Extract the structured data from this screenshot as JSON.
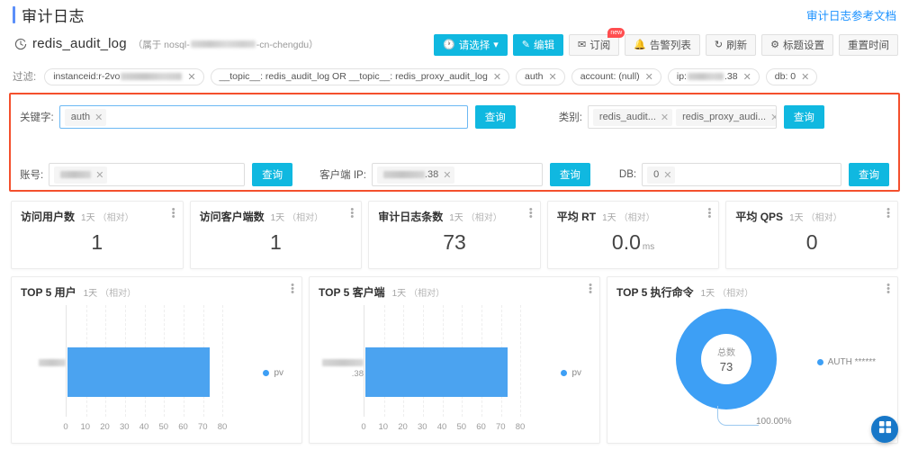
{
  "header": {
    "title": "审计日志",
    "doc_link": "审计日志参考文档"
  },
  "instance": {
    "name": "redis_audit_log",
    "sub_prefix": "（属于 nosql-",
    "sub_suffix": "-cn-chengdu）",
    "icon": "clock-refresh-icon"
  },
  "toolbar": {
    "time_select": "请选择",
    "edit": "编辑",
    "subscribe": "订阅",
    "subscribe_badge": "new",
    "alarm_list": "告警列表",
    "refresh": "刷新",
    "title_setting": "标题设置",
    "reset_time": "重置时间"
  },
  "filters": {
    "label": "过滤:",
    "tags": [
      {
        "text": "instanceid:r-2vo",
        "blurred": true,
        "blur_kind": "wide"
      },
      {
        "text": "__topic__: redis_audit_log OR __topic__: redis_proxy_audit_log",
        "blurred": false
      },
      {
        "text": "auth",
        "blurred": false
      },
      {
        "text": "account: (null)",
        "blurred": false
      },
      {
        "text": "ip:",
        "suffix": ".38",
        "blurred": true,
        "blur_kind": "ip"
      },
      {
        "text": "db: 0",
        "blurred": false
      }
    ]
  },
  "search_panel": {
    "accent_color": "#f4502d",
    "keyword": {
      "label": "关键字:",
      "chip": "auth",
      "button": "查询"
    },
    "category": {
      "label": "类别:",
      "chips": [
        "redis_audit...",
        "redis_proxy_audi..."
      ],
      "button": "查询"
    },
    "account": {
      "label": "账号:",
      "chip_blurred": true,
      "button": "查询"
    },
    "client_ip": {
      "label": "客户端 IP:",
      "chip_suffix": ".38",
      "chip_blurred": true,
      "button": "查询"
    },
    "db": {
      "label": "DB:",
      "chip": "0",
      "button": "查询"
    }
  },
  "metrics": [
    {
      "title": "访问用户数",
      "range": "1天",
      "relative": "（相对）",
      "value": "1",
      "unit": ""
    },
    {
      "title": "访问客户端数",
      "range": "1天",
      "relative": "（相对）",
      "value": "1",
      "unit": ""
    },
    {
      "title": "审计日志条数",
      "range": "1天",
      "relative": "（相对）",
      "value": "73",
      "unit": ""
    },
    {
      "title": "平均 RT",
      "range": "1天",
      "relative": "（相对）",
      "value": "0.0",
      "unit": "ms"
    },
    {
      "title": "平均 QPS",
      "range": "1天",
      "relative": "（相对）",
      "value": "0",
      "unit": ""
    }
  ],
  "charts": [
    {
      "title": "TOP 5 用户",
      "range": "1天",
      "relative": "（相对）",
      "legend": "pv"
    },
    {
      "title": "TOP 5 客户端",
      "range": "1天",
      "relative": "（相对）",
      "legend": "pv"
    },
    {
      "title": "TOP 5 执行命令",
      "range": "1天",
      "relative": "（相对）",
      "legend": "AUTH ******"
    }
  ],
  "donut": {
    "center_label": "总数",
    "center_value": "73",
    "percent_label": "100.00%"
  },
  "fab": {
    "icon": "grid-apps-icon"
  },
  "chart_data": [
    {
      "type": "bar",
      "orientation": "horizontal",
      "title": "TOP 5 用户",
      "categories": [
        "(user, blurred)"
      ],
      "values": [
        73
      ],
      "series": [
        {
          "name": "pv",
          "values": [
            73
          ]
        }
      ],
      "xlabel": "",
      "ylabel": "",
      "xlim": [
        0,
        80
      ],
      "xticks": [
        0,
        10,
        20,
        30,
        40,
        50,
        60,
        70,
        80
      ],
      "grid": true,
      "legend_position": "right",
      "color": "#4ba3f0"
    },
    {
      "type": "bar",
      "orientation": "horizontal",
      "title": "TOP 5 客户端",
      "categories": [
        "(ip, blurred).38"
      ],
      "values": [
        73
      ],
      "series": [
        {
          "name": "pv",
          "values": [
            73
          ]
        }
      ],
      "xlabel": "",
      "ylabel": "",
      "xlim": [
        0,
        80
      ],
      "xticks": [
        0,
        10,
        20,
        30,
        40,
        50,
        60,
        70,
        80
      ],
      "grid": true,
      "legend_position": "right",
      "color": "#4ba3f0"
    },
    {
      "type": "pie",
      "variant": "donut",
      "title": "TOP 5 执行命令",
      "labels": [
        "AUTH ******"
      ],
      "values": [
        73
      ],
      "percents": [
        "100.00%"
      ],
      "total_label": "总数",
      "total_value": 73,
      "legend_position": "right",
      "colors": [
        "#3d9ff5"
      ]
    }
  ]
}
